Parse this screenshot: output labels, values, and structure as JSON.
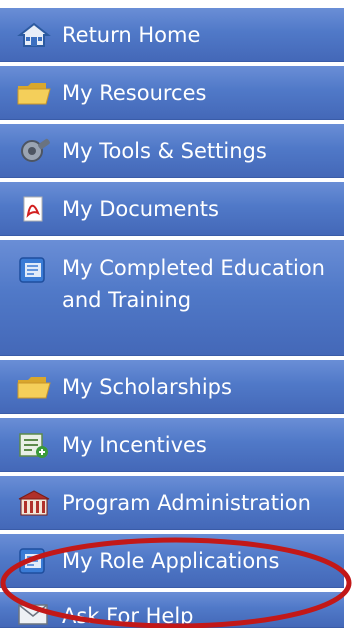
{
  "menu": {
    "items": [
      {
        "label": "Return Home",
        "icon": "home-icon"
      },
      {
        "label": "My Resources",
        "icon": "folder-icon"
      },
      {
        "label": "My Tools & Settings",
        "icon": "gear-icon"
      },
      {
        "label": "My Documents",
        "icon": "pdf-document-icon"
      },
      {
        "label": "My Completed Education\nand Training",
        "icon": "education-icon"
      },
      {
        "label": "My Scholarships",
        "icon": "folder-icon"
      },
      {
        "label": "My Incentives",
        "icon": "incentives-icon"
      },
      {
        "label": "Program Administration",
        "icon": "building-icon"
      },
      {
        "label": "My Role Applications",
        "icon": "role-applications-icon"
      },
      {
        "label": "Ask For Help",
        "icon": "help-mail-icon"
      }
    ]
  },
  "colors": {
    "menu_bg": "#5079c8",
    "annotation": "#c21818"
  }
}
